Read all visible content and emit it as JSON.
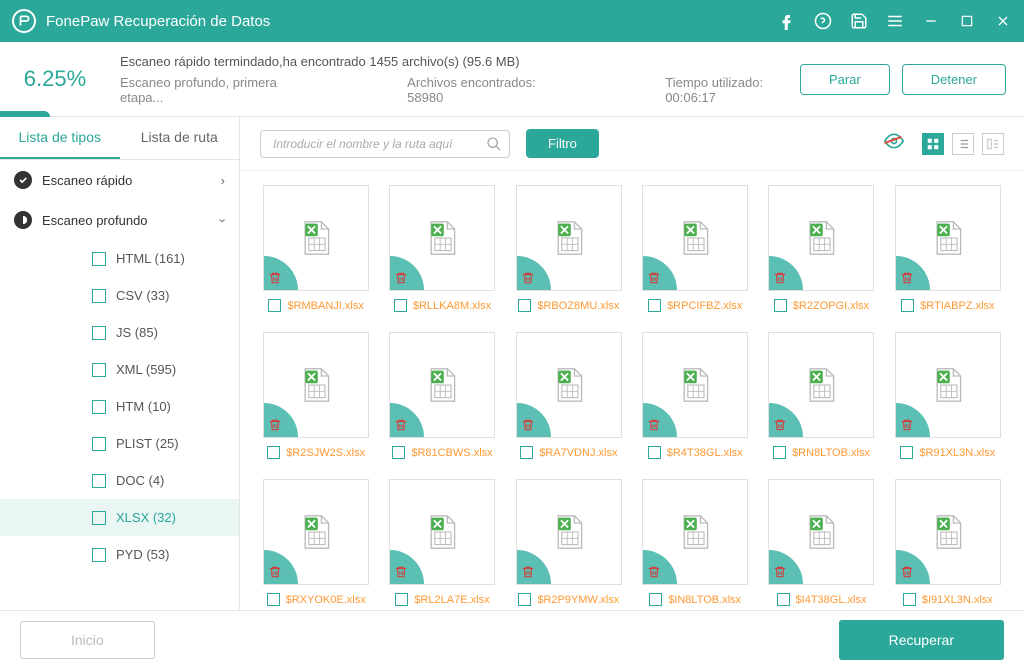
{
  "app": {
    "title": "FonePaw Recuperación de Datos"
  },
  "status": {
    "percent": "6.25%",
    "line1": "Escaneo rápido termindado,ha encontrado 1455 archivo(s) (95.6 MB)",
    "deep": "Escaneo profundo, primera etapa...",
    "found_label": "Archivos encontrados: 58980",
    "time_label": "Tiempo utilizado: 00:06:17",
    "stop_btn": "Parar",
    "pause_btn": "Detener"
  },
  "sidebar": {
    "tab_types": "Lista de tipos",
    "tab_path": "Lista de ruta",
    "quick_scan": "Escaneo rápido",
    "deep_scan": "Escaneo profundo",
    "items": [
      {
        "label": "HTML (161)"
      },
      {
        "label": "CSV (33)"
      },
      {
        "label": "JS (85)"
      },
      {
        "label": "XML (595)"
      },
      {
        "label": "HTM (10)"
      },
      {
        "label": "PLIST (25)"
      },
      {
        "label": "DOC (4)"
      },
      {
        "label": "XLSX (32)",
        "selected": true
      },
      {
        "label": "PYD (53)"
      }
    ]
  },
  "toolbar": {
    "search_placeholder": "Introducir el nombre y la ruta aquí",
    "filter": "Filtro"
  },
  "files": [
    {
      "name": "$RMBANJI.xlsx"
    },
    {
      "name": "$RLLKA8M.xlsx"
    },
    {
      "name": "$RBOZ8MU.xlsx"
    },
    {
      "name": "$RPCIFBZ.xlsx"
    },
    {
      "name": "$R2ZOPGI.xlsx"
    },
    {
      "name": "$RTIABPZ.xlsx"
    },
    {
      "name": "$R2SJW2S.xlsx"
    },
    {
      "name": "$R81CBWS.xlsx"
    },
    {
      "name": "$RA7VDNJ.xlsx"
    },
    {
      "name": "$R4T38GL.xlsx"
    },
    {
      "name": "$RN8LTOB.xlsx"
    },
    {
      "name": "$R91XL3N.xlsx"
    },
    {
      "name": "$RXYOK0E.xlsx"
    },
    {
      "name": "$RL2LA7E.xlsx"
    },
    {
      "name": "$R2P9YMW.xlsx"
    },
    {
      "name": "$IN8LTOB.xlsx"
    },
    {
      "name": "$I4T38GL.xlsx"
    },
    {
      "name": "$I91XL3N.xlsx"
    }
  ],
  "footer": {
    "home": "Inicio",
    "recover": "Recuperar"
  }
}
